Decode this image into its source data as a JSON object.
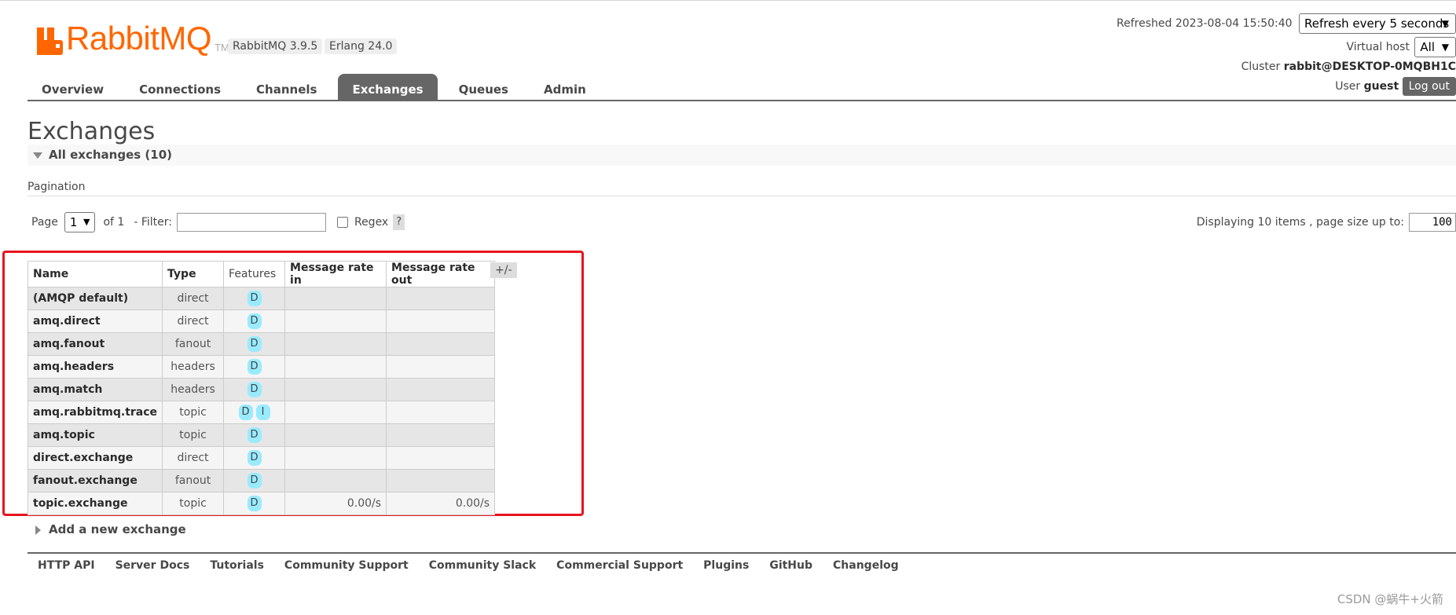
{
  "header": {
    "logo_text": "RabbitMQ",
    "logo_tm": "TM",
    "rabbitmq_version": "RabbitMQ 3.9.5",
    "erlang_version": "Erlang 24.0",
    "refreshed_label": "Refreshed 2023-08-04 15:50:40",
    "refresh_option": "Refresh every 5 seconds",
    "virtual_host_label": "Virtual host",
    "virtual_host_value": "All",
    "cluster_label": "Cluster",
    "cluster_value": "rabbit@DESKTOP-0MQBH1C",
    "user_label": "User",
    "user_value": "guest",
    "logout_label": "Log out"
  },
  "tabs": [
    {
      "label": "Overview",
      "active": false
    },
    {
      "label": "Connections",
      "active": false
    },
    {
      "label": "Channels",
      "active": false
    },
    {
      "label": "Exchanges",
      "active": true
    },
    {
      "label": "Queues",
      "active": false
    },
    {
      "label": "Admin",
      "active": false
    }
  ],
  "page": {
    "title": "Exchanges",
    "section_title": "All exchanges (10)",
    "pagination_label": "Pagination",
    "page_label": "Page",
    "page_value": "1",
    "of_label": "of 1",
    "filter_label": "- Filter:",
    "filter_value": "",
    "regex_label": "Regex",
    "help_label": "?",
    "displaying_label": "Displaying 10 items , page size up to:",
    "page_size_value": "100",
    "add_new_label": "Add a new exchange"
  },
  "table": {
    "columns": [
      "Name",
      "Type",
      "Features",
      "Message rate in",
      "Message rate out"
    ],
    "toggle_label": "+/-",
    "rows": [
      {
        "name": "(AMQP default)",
        "type": "direct",
        "features": [
          "D"
        ],
        "rate_in": "",
        "rate_out": ""
      },
      {
        "name": "amq.direct",
        "type": "direct",
        "features": [
          "D"
        ],
        "rate_in": "",
        "rate_out": ""
      },
      {
        "name": "amq.fanout",
        "type": "fanout",
        "features": [
          "D"
        ],
        "rate_in": "",
        "rate_out": ""
      },
      {
        "name": "amq.headers",
        "type": "headers",
        "features": [
          "D"
        ],
        "rate_in": "",
        "rate_out": ""
      },
      {
        "name": "amq.match",
        "type": "headers",
        "features": [
          "D"
        ],
        "rate_in": "",
        "rate_out": ""
      },
      {
        "name": "amq.rabbitmq.trace",
        "type": "topic",
        "features": [
          "D",
          "I"
        ],
        "rate_in": "",
        "rate_out": ""
      },
      {
        "name": "amq.topic",
        "type": "topic",
        "features": [
          "D"
        ],
        "rate_in": "",
        "rate_out": ""
      },
      {
        "name": "direct.exchange",
        "type": "direct",
        "features": [
          "D"
        ],
        "rate_in": "",
        "rate_out": ""
      },
      {
        "name": "fanout.exchange",
        "type": "fanout",
        "features": [
          "D"
        ],
        "rate_in": "",
        "rate_out": ""
      },
      {
        "name": "topic.exchange",
        "type": "topic",
        "features": [
          "D"
        ],
        "rate_in": "0.00/s",
        "rate_out": "0.00/s"
      }
    ]
  },
  "footer": {
    "links": [
      "HTTP API",
      "Server Docs",
      "Tutorials",
      "Community Support",
      "Community Slack",
      "Commercial Support",
      "Plugins",
      "GitHub",
      "Changelog"
    ]
  },
  "watermark": "CSDN @蜗牛+火箭",
  "colors": {
    "brand": "#ff6600",
    "active_tab": "#666666",
    "feature_badge": "#99ebff",
    "highlight_box": "#e8141c"
  }
}
